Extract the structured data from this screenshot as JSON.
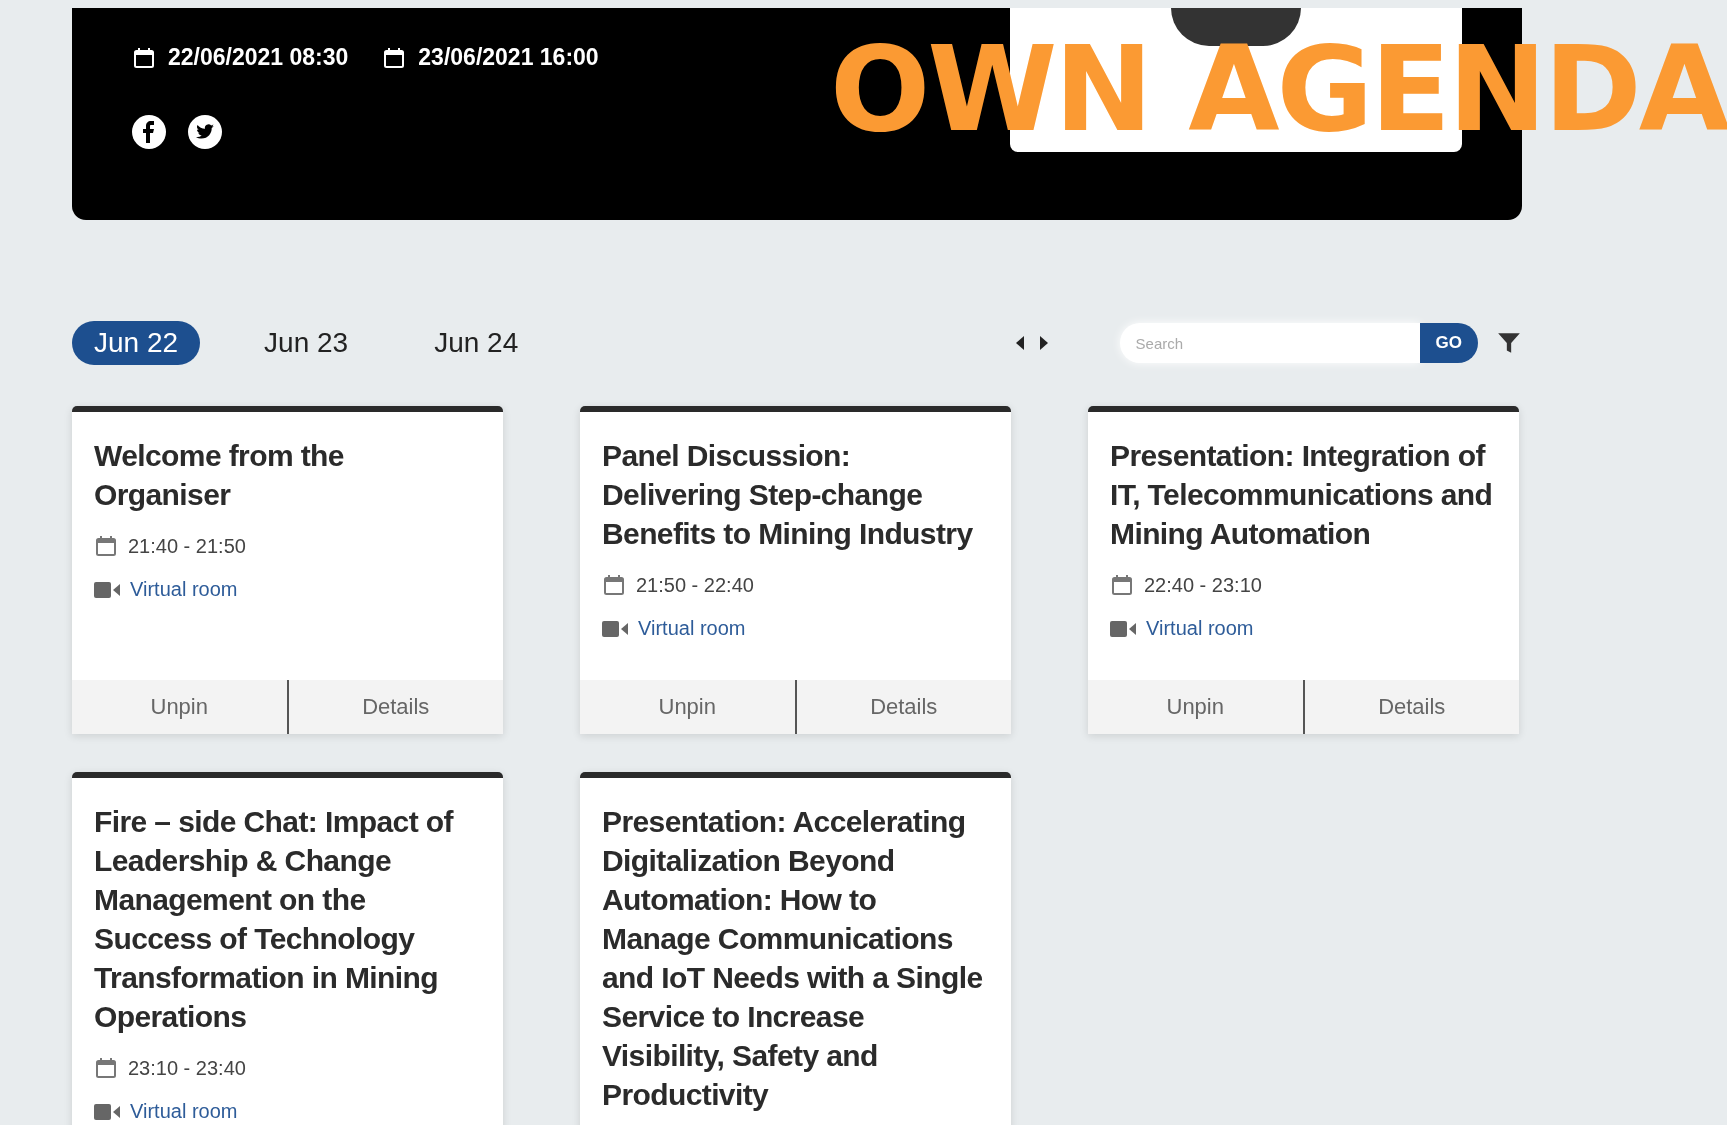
{
  "event": {
    "start": "22/06/2021 08:30",
    "end": "23/06/2021 16:00"
  },
  "overlay_heading": "OWN AGENDA",
  "day_tabs": [
    {
      "label": "Jun 22",
      "selected": true
    },
    {
      "label": "Jun 23",
      "selected": false
    },
    {
      "label": "Jun 24",
      "selected": false
    }
  ],
  "search": {
    "placeholder": "Search",
    "button": "GO"
  },
  "sessions": [
    {
      "title": "Welcome from the Organiser",
      "time": "21:40 - 21:50",
      "room": "Virtual room",
      "actions": [
        "Unpin",
        "Details"
      ]
    },
    {
      "title": "Panel Discussion: Delivering Step-change Benefits to Mining Industry",
      "time": "21:50 - 22:40",
      "room": "Virtual room",
      "actions": [
        "Unpin",
        "Details"
      ]
    },
    {
      "title": "Presentation: Integration of IT, Telecommunications and Mining Automation",
      "time": "22:40 - 23:10",
      "room": "Virtual room",
      "actions": [
        "Unpin",
        "Details"
      ]
    },
    {
      "title": "Fire – side Chat: Impact of Leadership & Change Management on the Success of Technology Transformation in Mining Operations",
      "time": "23:10 - 23:40",
      "room": "Virtual room"
    },
    {
      "title": "Presentation: Accelerating Digitalization Beyond Automation: How to Manage Communications and IoT Needs with a Single Service to Increase Visibility, Safety and Productivity"
    }
  ]
}
